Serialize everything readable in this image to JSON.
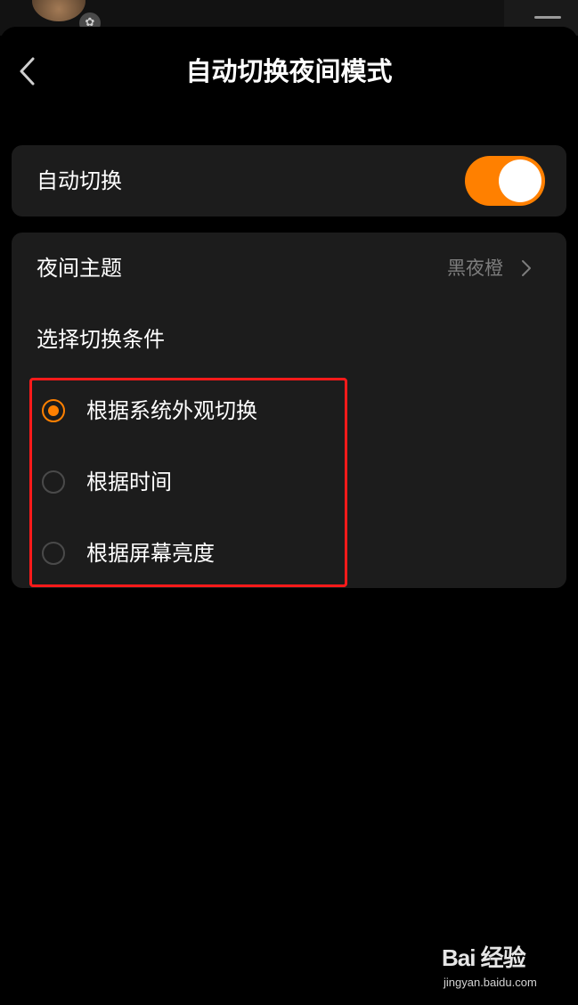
{
  "header": {
    "title": "自动切换夜间模式",
    "back_icon": "chevron-left-icon"
  },
  "auto_switch": {
    "label": "自动切换",
    "enabled": true,
    "accent_color": "#ff8000"
  },
  "night_theme": {
    "label": "夜间主题",
    "value": "黑夜橙"
  },
  "conditions": {
    "section_label": "选择切换条件",
    "options": [
      {
        "label": "根据系统外观切换",
        "selected": true
      },
      {
        "label": "根据时间",
        "selected": false
      },
      {
        "label": "根据屏幕亮度",
        "selected": false
      }
    ]
  },
  "annotation": {
    "highlight_color": "#ff1a1a"
  },
  "watermark": {
    "logo_text": "Bai 经验",
    "url": "jingyan.baidu.com"
  }
}
